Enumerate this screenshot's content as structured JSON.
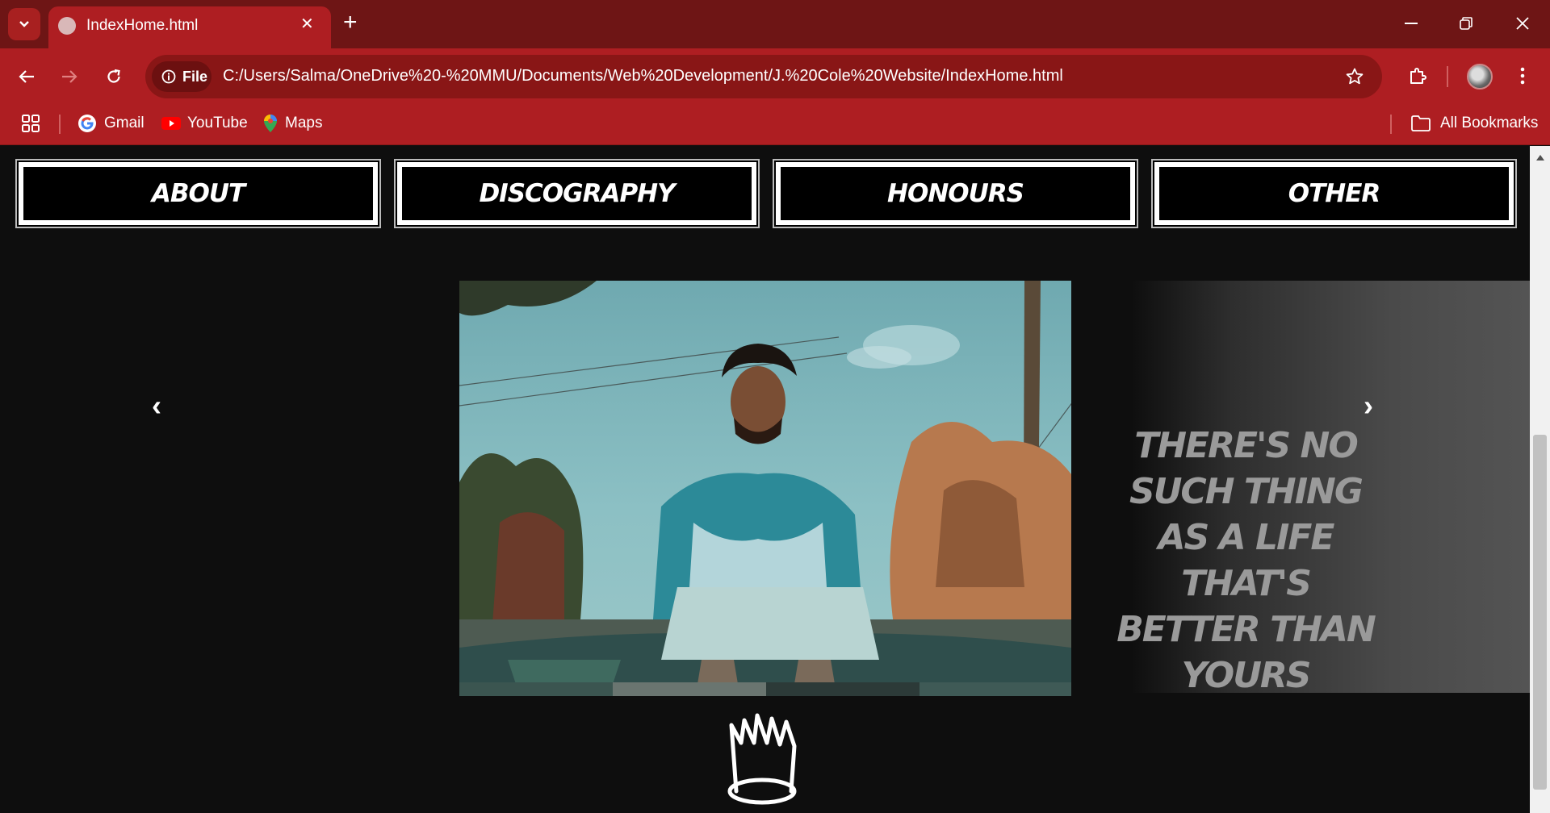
{
  "browser": {
    "tab_title": "IndexHome.html",
    "url": "C:/Users/Salma/OneDrive%20-%20MMU/Documents/Web%20Development/J.%20Cole%20Website/IndexHome.html",
    "site_chip": "File",
    "bookmarks": [
      "Gmail",
      "YouTube",
      "Maps"
    ],
    "all_bookmarks": "All Bookmarks"
  },
  "nav": {
    "items": [
      "ABOUT",
      "DISCOGRAPHY",
      "HONOURS",
      "OTHER"
    ]
  },
  "slideshow": {
    "quote": "THERE'S NO SUCH THING AS A LIFE THAT'S BETTER THAN YOURS",
    "prev": "‹",
    "next": "›"
  },
  "colors": {
    "tabbar": "#6e1515",
    "toolbar": "#ae1e22",
    "page_bg": "#0e0e0e"
  }
}
